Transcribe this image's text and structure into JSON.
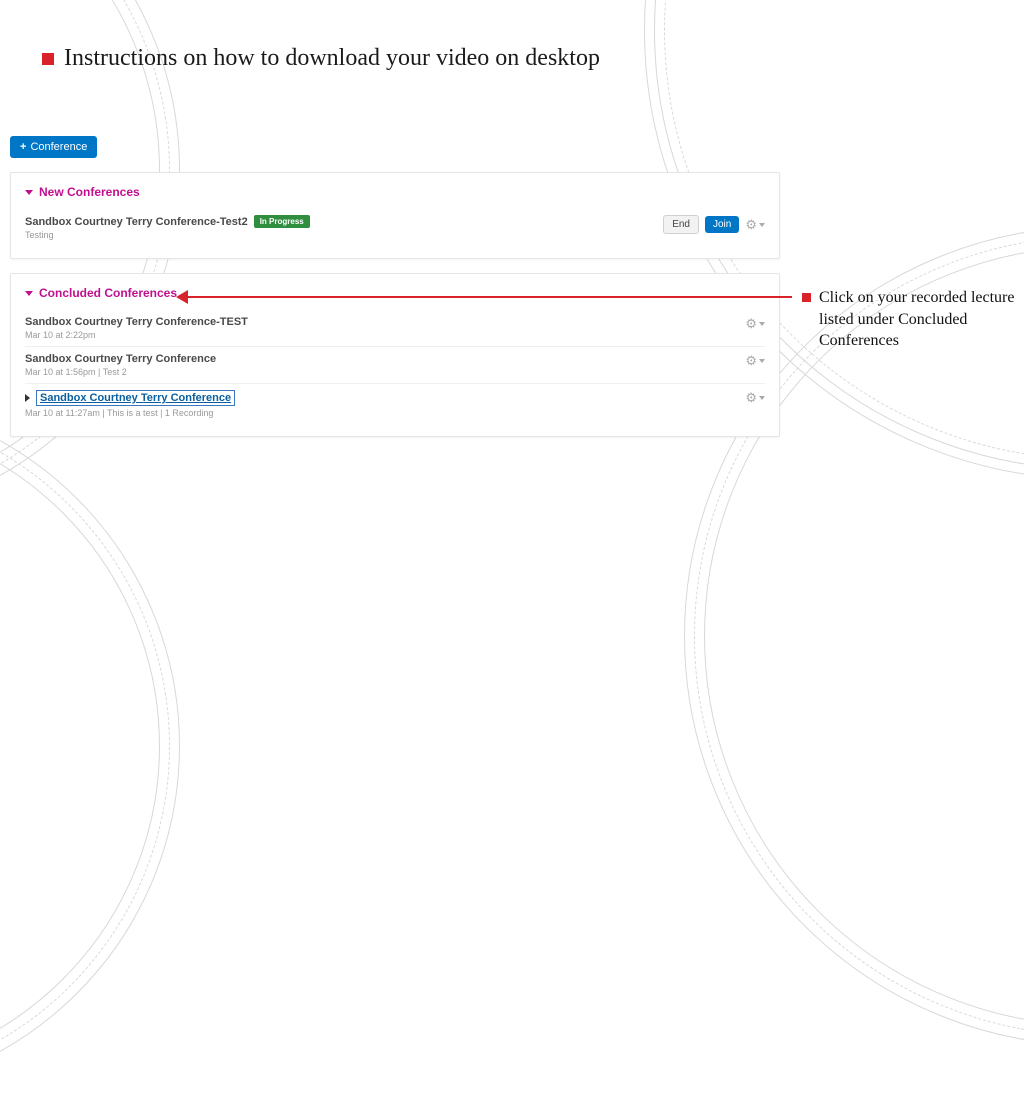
{
  "title": "Instructions on how to download your video on desktop",
  "callout": "Click on your recorded lecture listed under Concluded Conferences",
  "add_button_icon": "+",
  "add_button_label": "Conference",
  "sections": {
    "new": {
      "header": "New Conferences",
      "row": {
        "title": "Sandbox Courtney Terry Conference-Test2",
        "badge": "In Progress",
        "meta": "Testing",
        "end_label": "End",
        "join_label": "Join"
      }
    },
    "concluded": {
      "header": "Concluded Conferences",
      "rows": [
        {
          "title": "Sandbox Courtney Terry Conference-TEST",
          "meta": "Mar 10 at 2:22pm"
        },
        {
          "title": "Sandbox Courtney Terry Conference",
          "meta": "Mar 10 at 1:56pm  |  Test 2"
        },
        {
          "title": "Sandbox Courtney Terry Conference",
          "meta": "Mar 10 at 11:27am  |  This is a test  |  1 Recording"
        }
      ]
    }
  }
}
